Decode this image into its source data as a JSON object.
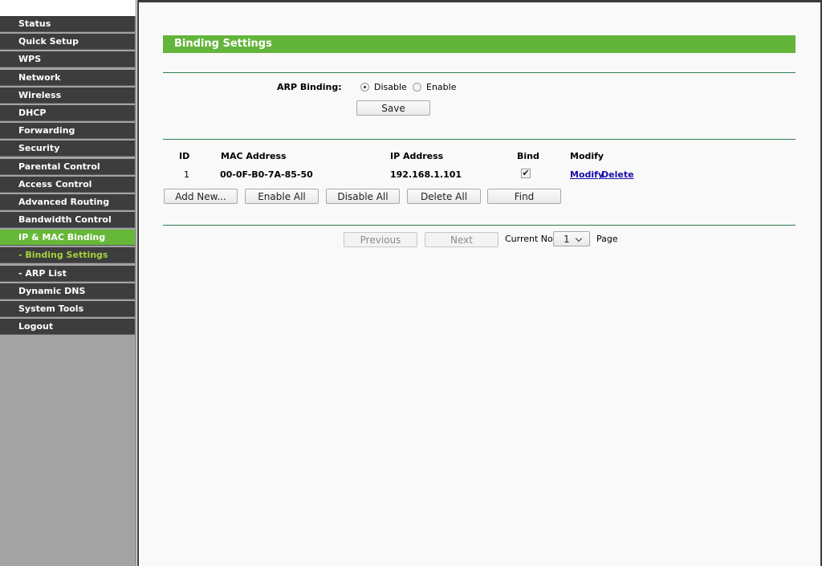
{
  "menu": [
    {
      "label": "Status"
    },
    {
      "label": "Quick Setup"
    },
    {
      "label": "WPS"
    },
    {
      "label": "Network"
    },
    {
      "label": "Wireless"
    },
    {
      "label": "DHCP"
    },
    {
      "label": "Forwarding"
    },
    {
      "label": "Security"
    },
    {
      "label": "Parental Control"
    },
    {
      "label": "Access Control"
    },
    {
      "label": "Advanced Routing"
    },
    {
      "label": "Bandwidth Control"
    },
    {
      "label": "IP & MAC Binding"
    },
    {
      "label": "- Binding Settings"
    },
    {
      "label": "- ARP List"
    },
    {
      "label": "Dynamic DNS"
    },
    {
      "label": "System Tools"
    },
    {
      "label": "Logout"
    }
  ],
  "page": {
    "title": "Binding Settings"
  },
  "arp": {
    "label": "ARP Binding:",
    "disable_label": "Disable",
    "enable_label": "Enable",
    "selected": "Disable",
    "save_label": "Save"
  },
  "table": {
    "headers": {
      "id": "ID",
      "mac": "MAC Address",
      "ip": "IP Address",
      "bind": "Bind",
      "modify": "Modify"
    },
    "rows": [
      {
        "id": "1",
        "mac": "00-0F-B0-7A-85-50",
        "ip": "192.168.1.101",
        "bind_checked": true,
        "modify_link": "Modify",
        "delete_link": "Delete"
      }
    ]
  },
  "actions": {
    "add_new": "Add New...",
    "enable_all": "Enable All",
    "disable_all": "Disable All",
    "delete_all": "Delete All",
    "find": "Find"
  },
  "pagination": {
    "previous": "Previous",
    "next": "Next",
    "current_label": "Current No.",
    "current_value": "1",
    "page_label": "Page"
  },
  "colors": {
    "accent_green": "#62b53a",
    "menu_dark": "#3d3d3d",
    "sub_active_text": "#a7d23a",
    "link_blue": "#1a0dab"
  }
}
